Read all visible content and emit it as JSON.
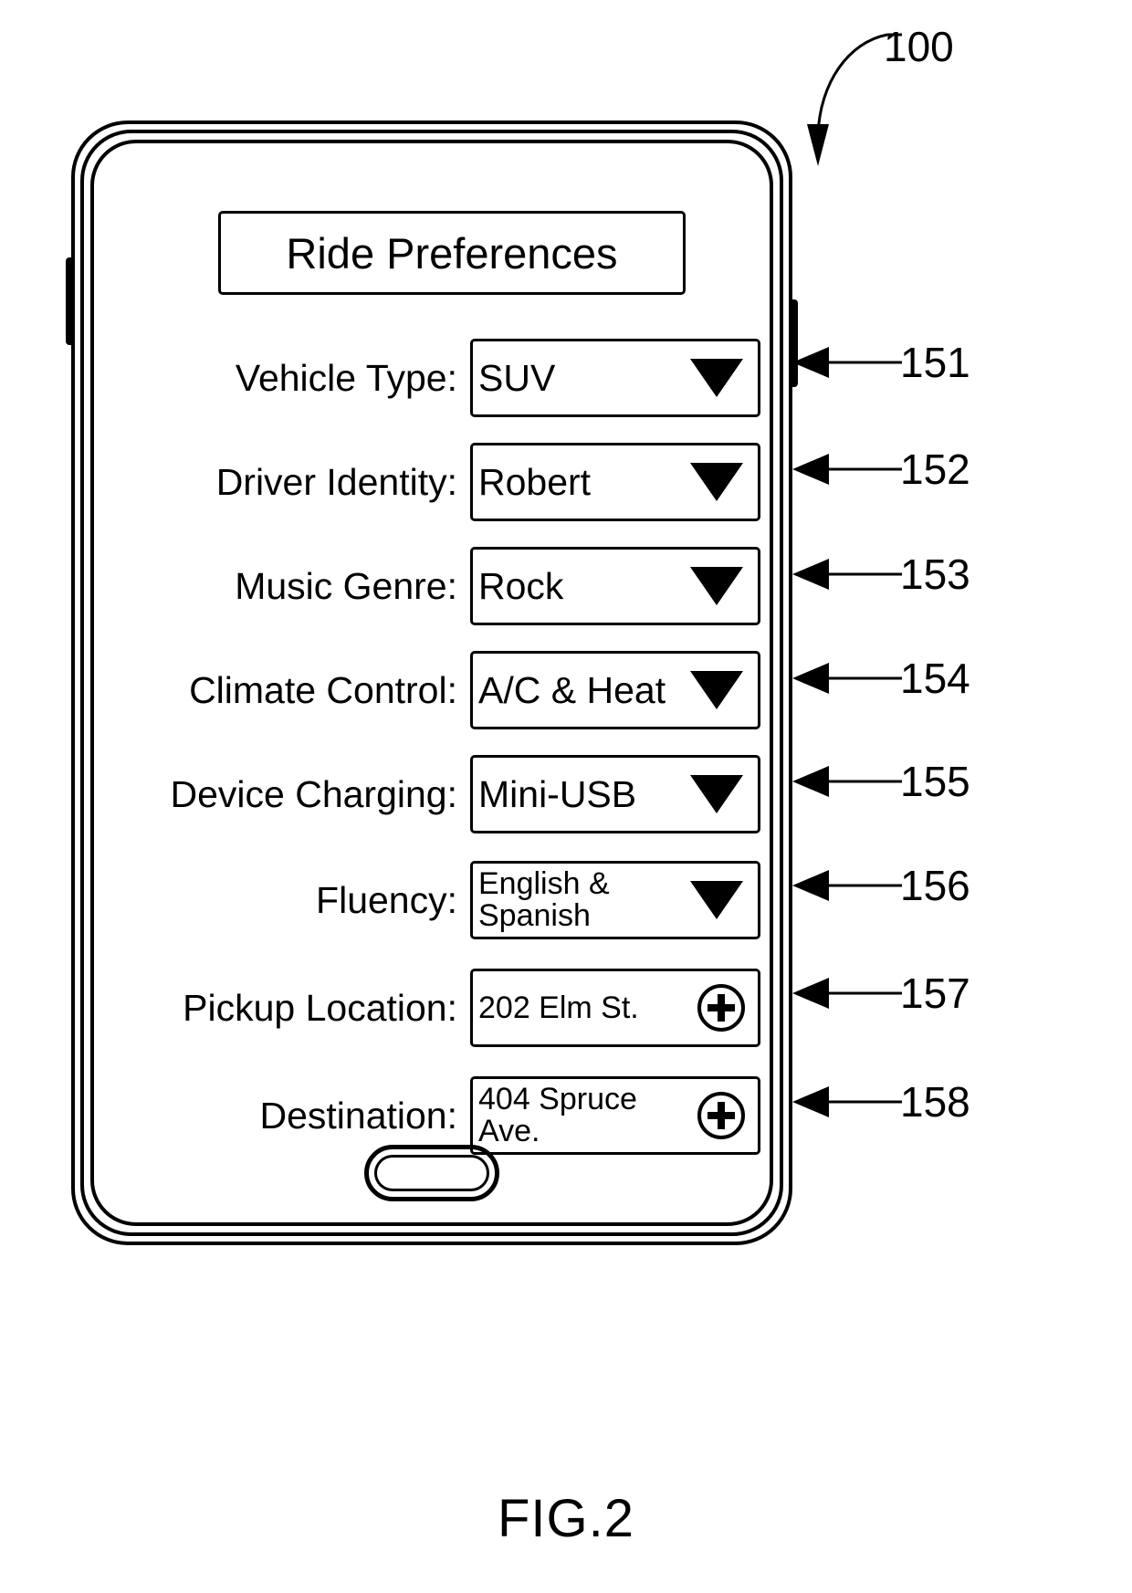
{
  "figure": {
    "caption": "FIG.2",
    "device_reference": "100"
  },
  "device": {
    "screen": {
      "title": "Ride Preferences",
      "fields": [
        {
          "label": "Vehicle Type:",
          "value": "SUV",
          "control": "dropdown",
          "control_icon": "chevron-down-icon",
          "reference": "151"
        },
        {
          "label": "Driver Identity:",
          "value": "Robert",
          "control": "dropdown",
          "control_icon": "chevron-down-icon",
          "reference": "152"
        },
        {
          "label": "Music Genre:",
          "value": "Rock",
          "control": "dropdown",
          "control_icon": "chevron-down-icon",
          "reference": "153"
        },
        {
          "label": "Climate Control:",
          "value": "A/C & Heat",
          "control": "dropdown",
          "control_icon": "chevron-down-icon",
          "reference": "154"
        },
        {
          "label": "Device Charging:",
          "value": "Mini-USB",
          "control": "dropdown",
          "control_icon": "chevron-down-icon",
          "reference": "155"
        },
        {
          "label": "Fluency:",
          "value": "English &\nSpanish",
          "control": "dropdown",
          "control_icon": "chevron-down-icon",
          "reference": "156"
        },
        {
          "label": "Pickup Location:",
          "value": "202 Elm St.",
          "control": "add",
          "control_icon": "plus-circle-icon",
          "reference": "157"
        },
        {
          "label": "Destination:",
          "value": "404 Spruce\nAve.",
          "control": "add",
          "control_icon": "plus-circle-icon",
          "reference": "158"
        }
      ]
    },
    "home_button_label": "home-button"
  },
  "colors": {
    "line": "#000000",
    "background": "#ffffff"
  }
}
